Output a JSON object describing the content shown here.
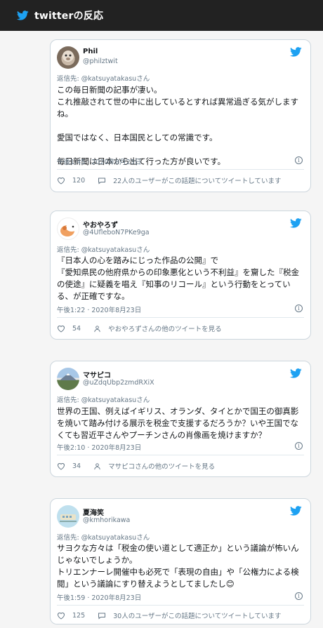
{
  "header": {
    "title": "twitterの反応"
  },
  "colors": {
    "twitter_blue": "#1da1f2",
    "header_bg": "#222222"
  },
  "tweets": [
    {
      "name": "Phil",
      "handle": "@philztwit",
      "replying": "返信先: @katsuyatakasuさん",
      "text": "この毎日新聞の記事が凄い。\nこれ推敲されて世の中に出しているとすれば異常過ぎる気がしますね。\n\n愛国ではなく、日本国民としての常識です。\n\n毎日新聞は日本から出て行った方が良いです。",
      "time": "午後1:45 · 2020年8月23日",
      "likes": "120",
      "secondary": "22人のユーザーがこの話題についてツイートしています",
      "secondary_icon": "chat-icon"
    },
    {
      "name": "やおやろず",
      "handle": "@4UfleboN7PKe9ga",
      "replying": "返信先: @katsuyatakasuさん",
      "text": "『日本人の心を踏みにじった作品の公開』で\n『愛知県民の他府県からの印象悪化という不利益』を齎した『税金の使途』に疑義を唱え『知事のリコール』という行動をとっている、が正確ですな。",
      "time": "午後1:22 · 2020年8月23日",
      "likes": "54",
      "secondary": "やおやろずさんの他のツイートを見る",
      "secondary_icon": "person-icon"
    },
    {
      "name": "マサピコ",
      "handle": "@uZdqUbp2zmdRXiX",
      "replying": "返信先: @katsuyatakasuさん",
      "text": "世界の王国、例えばイギリス、オランダ、タイとかで国王の御真影を焼いて踏み付ける展示を税金で支援するだろうか？いや王国でなくても習近平さんやプーチンさんの肖像画を焼けますか？",
      "time": "午後2:10 · 2020年8月23日",
      "likes": "34",
      "secondary": "マサピコさんの他のツイートを見る",
      "secondary_icon": "person-icon"
    },
    {
      "name": "夏海笑",
      "handle": "@kmhorikawa",
      "replying": "返信先: @katsuyatakasuさん",
      "text": "サヨクな方々は「税金の使い道として適正か」という議論が怖いんじゃないでしょうか。\nトリエンナーレ開催中も必死で「表現の自由」や「公権力による検閲」という議論にすり替えようとしてましたし😊",
      "time": "午後1:59 · 2020年8月23日",
      "likes": "125",
      "secondary": "30人のユーザーがこの話題についてツイートしています",
      "secondary_icon": "chat-icon"
    }
  ]
}
